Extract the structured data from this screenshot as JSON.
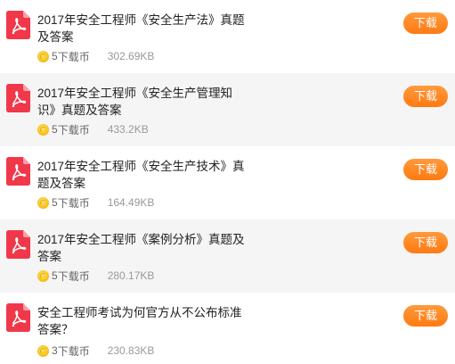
{
  "download_label": "下载",
  "coin_unit": "下载币",
  "items": [
    {
      "title": "2017年安全工程师《安全生产法》真题及答案",
      "coins": "5",
      "size": "302.69KB"
    },
    {
      "title": "2017年安全工程师《安全生产管理知识》真题及答案",
      "coins": "5",
      "size": "433.2KB"
    },
    {
      "title": "2017年安全工程师《安全生产技术》真题及答案",
      "coins": "5",
      "size": "164.49KB"
    },
    {
      "title": "2017年安全工程师《案例分析》真题及答案",
      "coins": "5",
      "size": "280.17KB"
    },
    {
      "title": "安全工程师考试为何官方从不公布标准答案？",
      "coins": "3",
      "size": "230.83KB"
    }
  ]
}
